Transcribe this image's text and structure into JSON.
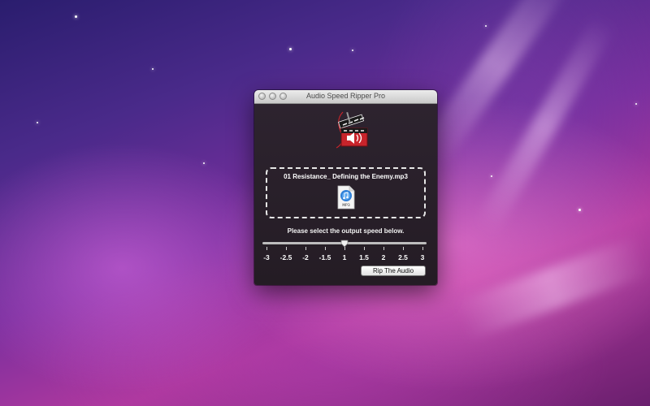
{
  "window": {
    "title": "Audio Speed Ripper Pro"
  },
  "logo": {
    "icon": "clapperboard-speaker-icon"
  },
  "dropzone": {
    "filename": "01 Resistance_ Defining the Enemy.mp3",
    "file_icon": "mp3-file-icon",
    "file_icon_label": "MP3"
  },
  "speed": {
    "prompt": "Please select the output speed below.",
    "labels": [
      "-3",
      "-2.5",
      "-2",
      "-1.5",
      "1",
      "1.5",
      "2",
      "2.5",
      "3"
    ],
    "selected_label": "1"
  },
  "actions": {
    "rip_label": "Rip The Audio"
  },
  "colors": {
    "window_bg": "#2a2129",
    "accent_red": "#c8242b"
  }
}
